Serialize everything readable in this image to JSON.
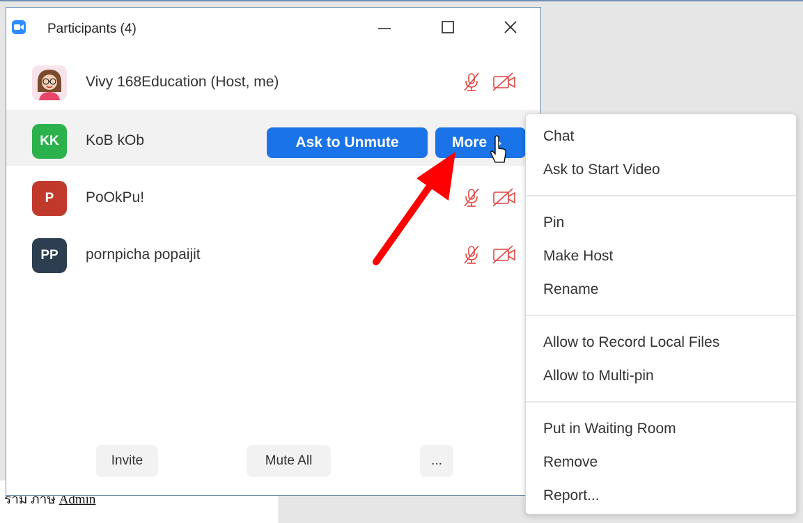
{
  "window": {
    "title": "Participants (4)"
  },
  "participants": [
    {
      "name": "Vivy 168Education (Host, me)",
      "initials": "",
      "avatar_color": "#f6d9e2"
    },
    {
      "name": "KoB kOb",
      "initials": "KK",
      "avatar_color": "#2bb24c"
    },
    {
      "name": "PoOkPu!",
      "initials": "P",
      "avatar_color": "#c0392b"
    },
    {
      "name": "pornpicha popaijit",
      "initials": "PP",
      "avatar_color": "#2c3e50"
    }
  ],
  "row_actions": {
    "ask_to_unmute": "Ask to Unmute",
    "more": "More"
  },
  "footer": {
    "invite": "Invite",
    "mute_all": "Mute All",
    "more": "..."
  },
  "context_menu": {
    "groups": [
      [
        "Chat",
        "Ask to Start Video"
      ],
      [
        "Pin",
        "Make Host",
        "Rename"
      ],
      [
        "Allow to Record Local Files",
        "Allow to Multi-pin"
      ],
      [
        "Put in Waiting Room",
        "Remove",
        "Report..."
      ]
    ]
  },
  "background_doc": {
    "text_prefix": "ราม ภาษ",
    "link_text": "Admin"
  },
  "colors": {
    "accent_blue": "#1a73e8",
    "muted_red": "#e0443e",
    "arrow_red": "#ff0000"
  }
}
